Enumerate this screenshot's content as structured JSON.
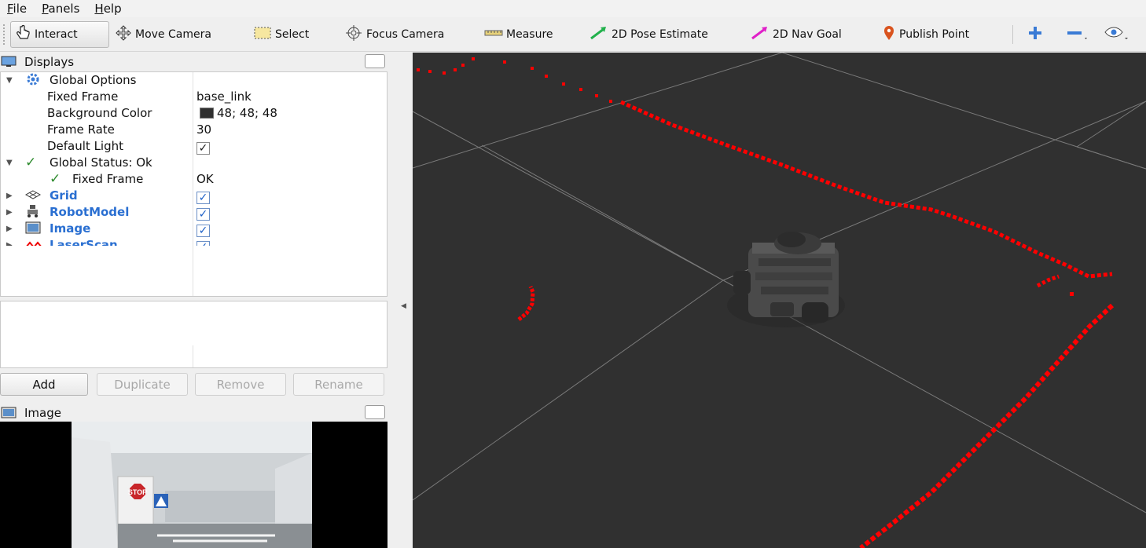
{
  "menu": [
    {
      "first": "F",
      "rest": "ile"
    },
    {
      "first": "P",
      "rest": "anels"
    },
    {
      "first": "H",
      "rest": "elp"
    }
  ],
  "toolbar": {
    "interact": "Interact",
    "move_camera": "Move Camera",
    "select": "Select",
    "focus_camera": "Focus Camera",
    "measure": "Measure",
    "pose_estimate": "2D Pose Estimate",
    "nav_goal": "2D Nav Goal",
    "publish_point": "Publish Point"
  },
  "displays_panel": {
    "title": "Displays",
    "rows": {
      "global_options": "Global Options",
      "fixed_frame_label": "Fixed Frame",
      "fixed_frame_value": "base_link",
      "bg_color_label": "Background Color",
      "bg_color_value": "48; 48; 48",
      "frame_rate_label": "Frame Rate",
      "frame_rate_value": "30",
      "default_light_label": "Default Light",
      "global_status": "Global Status: Ok",
      "status_fixed_frame_label": "Fixed Frame",
      "status_fixed_frame_value": "OK",
      "grid": "Grid",
      "robot_model": "RobotModel",
      "image": "Image",
      "laser_scan": "LaserScan"
    },
    "buttons": {
      "add": "Add",
      "duplicate": "Duplicate",
      "remove": "Remove",
      "rename": "Rename"
    }
  },
  "image_panel": {
    "title": "Image",
    "sign_text": "STOP"
  },
  "colors": {
    "viewport_bg": "#303030",
    "laser": "#ff0000",
    "pose_arrow": "#22b14c",
    "nav_arrow": "#e020c8",
    "link_blue": "#2a6fd1"
  }
}
